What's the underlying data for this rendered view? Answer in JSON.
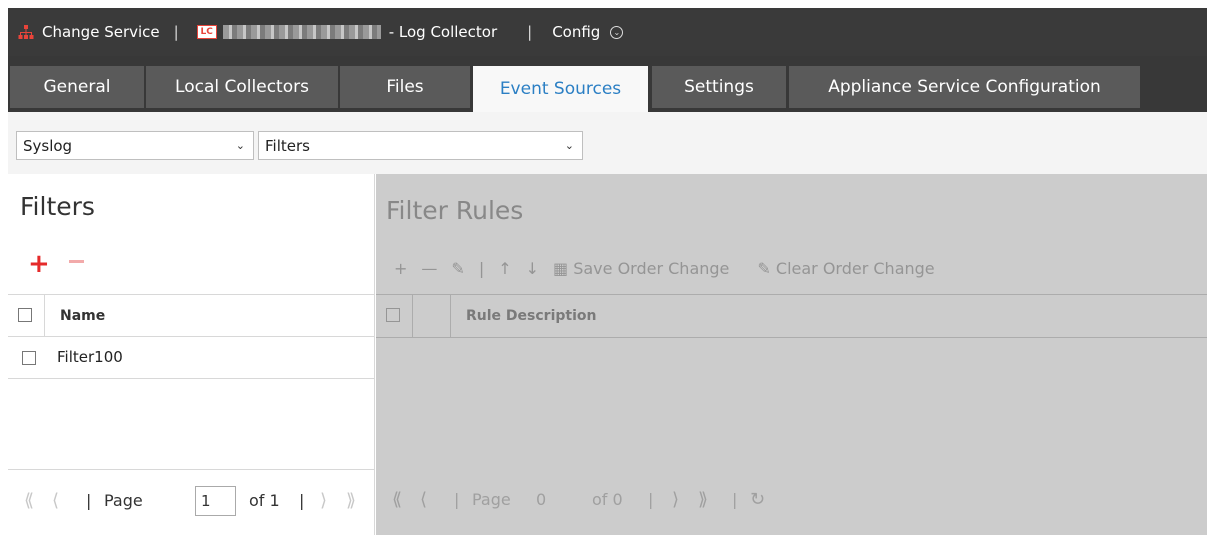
{
  "topbar": {
    "change_service_label": "Change Service",
    "service_suffix": "- Log Collector",
    "config_label": "Config",
    "lc_badge": "LC",
    "separator": "|"
  },
  "tabs": [
    {
      "label": "General"
    },
    {
      "label": "Local Collectors"
    },
    {
      "label": "Files"
    },
    {
      "label": "Event Sources",
      "active": true
    },
    {
      "label": "Settings"
    },
    {
      "label": "Appliance Service Configuration"
    }
  ],
  "selects": {
    "type_value": "Syslog",
    "view_value": "Filters"
  },
  "filters_panel": {
    "title": "Filters",
    "column_name": "Name",
    "rows": [
      {
        "name": "Filter100"
      }
    ],
    "pager": {
      "page_label": "Page",
      "page_value": "1",
      "of_label": "of 1"
    }
  },
  "rules_panel": {
    "title": "Filter Rules",
    "save_order_label": "Save Order Change",
    "clear_order_label": "Clear Order Change",
    "column_description": "Rule Description",
    "pager": {
      "page_label": "Page",
      "page_value": "0",
      "of_label": "of 0"
    }
  },
  "colors": {
    "accent": "#2b7fc4",
    "add_red": "#e52a2a",
    "header_bg": "#3a3a3a"
  },
  "icons": [
    "network-icon",
    "lc-icon",
    "chevron-down-circle-icon",
    "add-icon",
    "remove-icon",
    "edit-icon",
    "arrow-up-icon",
    "arrow-down-icon",
    "save-icon",
    "eraser-icon",
    "first-page-icon",
    "prev-page-icon",
    "next-page-icon",
    "last-page-icon",
    "refresh-icon"
  ]
}
